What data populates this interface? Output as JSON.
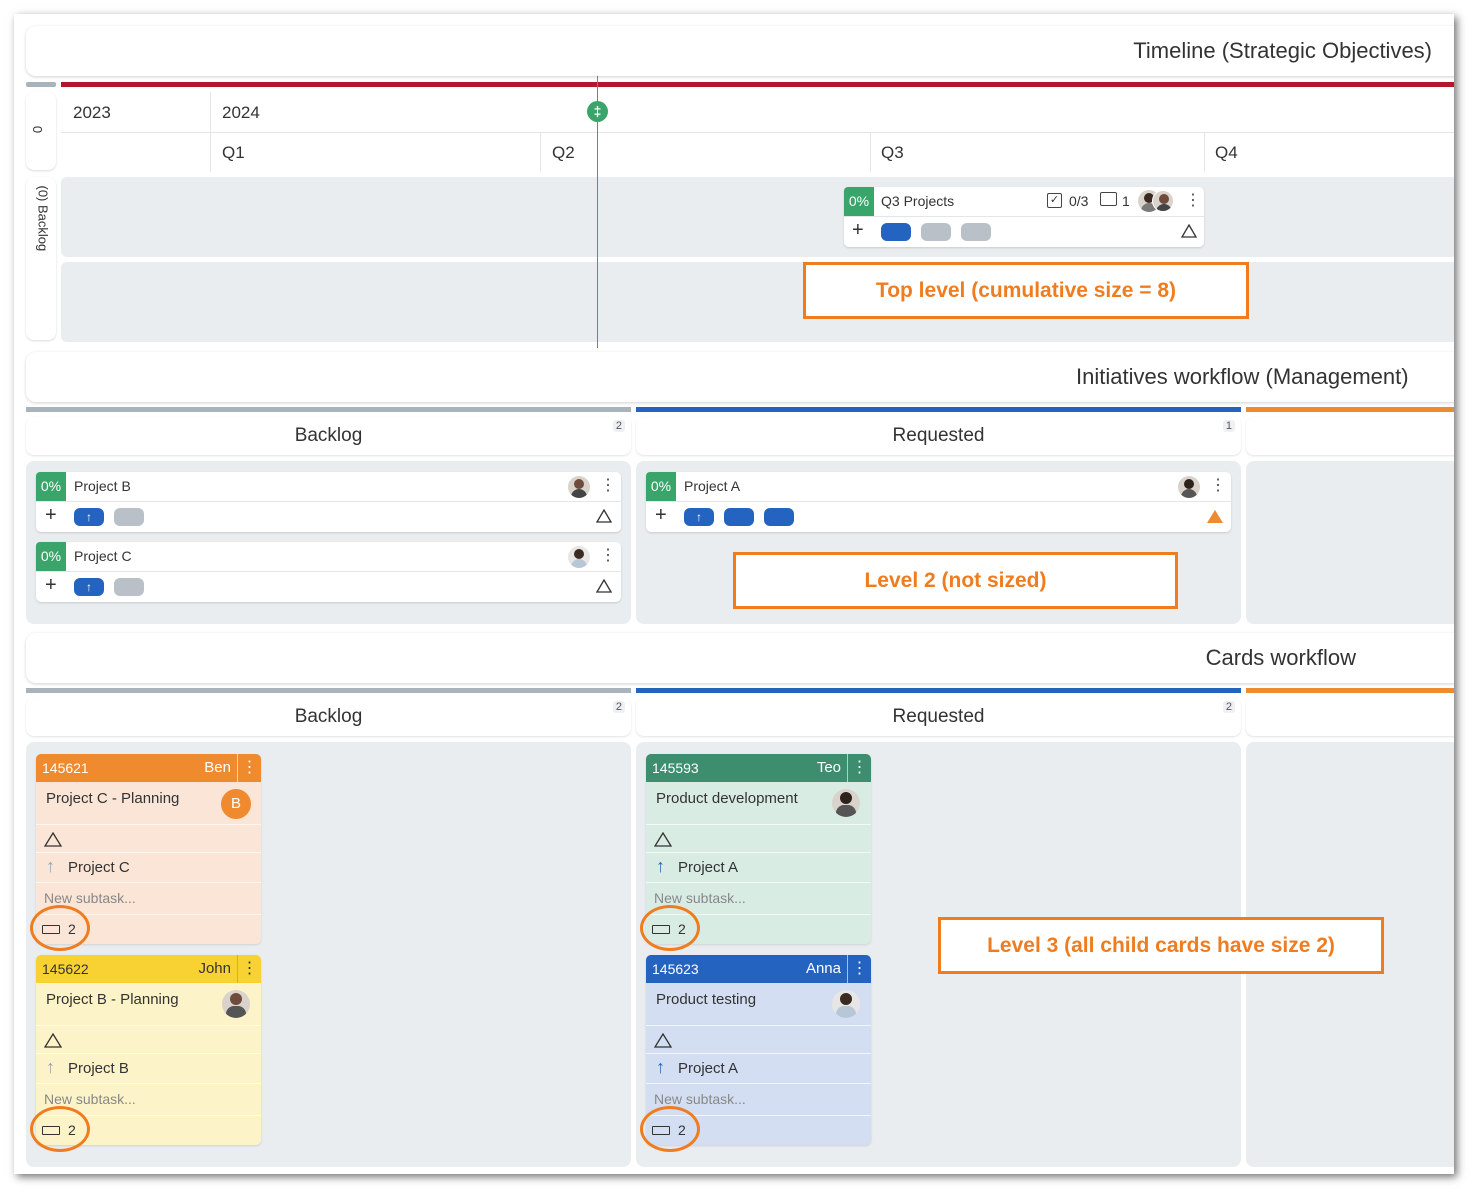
{
  "timeline": {
    "title": "Timeline (Strategic Objectives)",
    "lane_top_label": "0",
    "lane_backlog_label": "(0) Backlog",
    "years": [
      "2023",
      "2024"
    ],
    "quarters": [
      "Q1",
      "Q2",
      "Q3",
      "Q4"
    ],
    "today_marker": "‡",
    "card": {
      "percent": "0%",
      "name": "Q3 Projects",
      "checklist": "0/3",
      "comments": "1"
    },
    "callout": "Top level (cumulative size = 8)"
  },
  "initiatives": {
    "title": "Initiatives workflow (Management)",
    "columns": [
      {
        "name": "Backlog",
        "count": "2"
      },
      {
        "name": "Requested",
        "count": "1"
      }
    ],
    "cards": [
      {
        "percent": "0%",
        "name": "Project B"
      },
      {
        "percent": "0%",
        "name": "Project C"
      },
      {
        "percent": "0%",
        "name": "Project A"
      }
    ],
    "callout": "Level 2 (not sized)"
  },
  "cards_workflow": {
    "title": "Cards workflow",
    "columns": [
      {
        "name": "Backlog",
        "count": "2"
      },
      {
        "name": "Requested",
        "count": "2"
      }
    ],
    "cards": [
      {
        "id": "145621",
        "owner": "Ben",
        "title": "Project C - Planning",
        "parent": "Project C",
        "subtask": "New subtask...",
        "size": "2",
        "initial": "B",
        "color": "#ef8a2e",
        "bg": "#fbe5d6"
      },
      {
        "id": "145622",
        "owner": "John",
        "title": "Project B - Planning",
        "parent": "Project B",
        "subtask": "New subtask...",
        "size": "2",
        "color": "#f8d232",
        "bg": "#fdf3c8"
      },
      {
        "id": "145593",
        "owner": "Teo",
        "title": "Product development",
        "parent": "Project A",
        "subtask": "New subtask...",
        "size": "2",
        "color": "#3d8d6f",
        "bg": "#d9ece4"
      },
      {
        "id": "145623",
        "owner": "Anna",
        "title": "Product testing",
        "parent": "Project A",
        "subtask": "New subtask...",
        "size": "2",
        "color": "#2563c0",
        "bg": "#d3def2"
      }
    ],
    "callout": "Level 3 (all child cards have size 2)"
  },
  "colors": {
    "timeline_bar": "#b5162b",
    "backlog_bar": "#a9b3bc",
    "requested_bar": "#2563c0",
    "next_bar": "#ef8a2e",
    "callout": "#ef7d1f",
    "percent": "#3aa56b"
  }
}
